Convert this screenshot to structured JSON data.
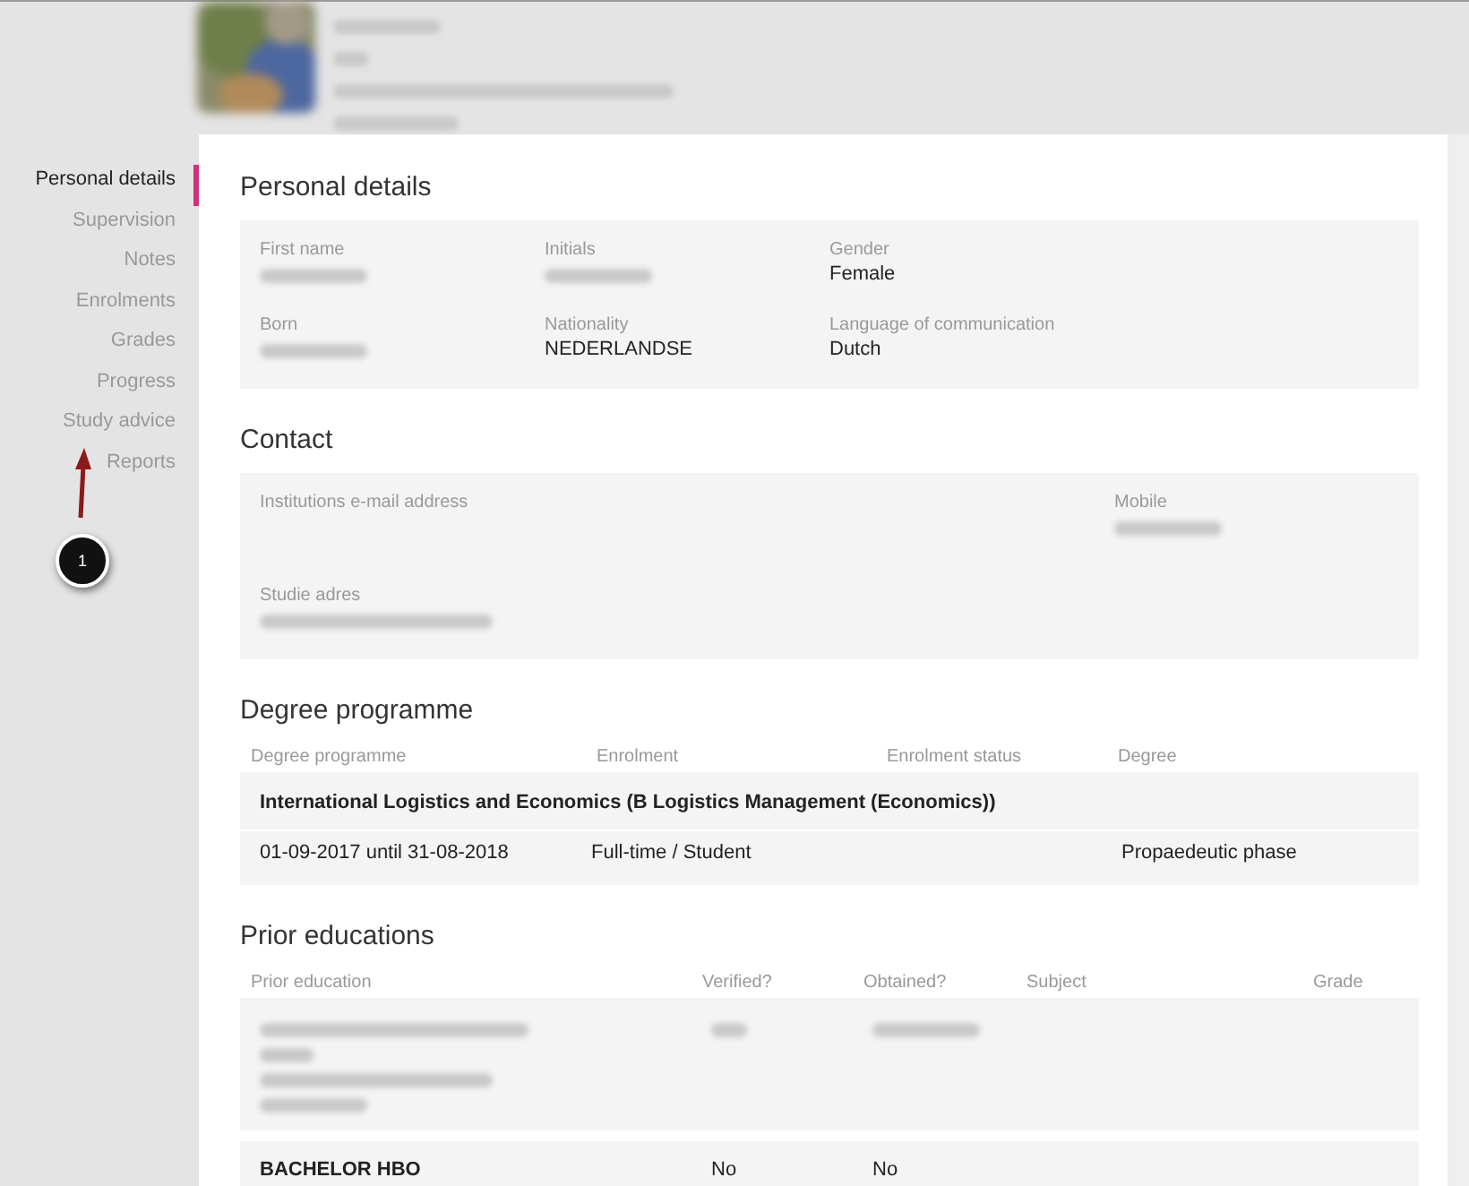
{
  "sidebar": {
    "items": [
      {
        "label": "Personal details",
        "selected": true
      },
      {
        "label": "Supervision",
        "selected": false
      },
      {
        "label": "Notes",
        "selected": false
      },
      {
        "label": "Enrolments",
        "selected": false
      },
      {
        "label": "Grades",
        "selected": false
      },
      {
        "label": "Progress",
        "selected": false
      },
      {
        "label": "Study advice",
        "selected": false
      },
      {
        "label": "Reports",
        "selected": false
      }
    ]
  },
  "annotation": {
    "badge": "1"
  },
  "sections": [
    {
      "kind": "details",
      "title": "Personal details",
      "rows": [
        [
          {
            "label": "First name",
            "redacted": true
          },
          {
            "label": "Initials",
            "redacted": true
          },
          {
            "label": "Gender",
            "value": "Female"
          }
        ],
        [
          {
            "label": "Born",
            "redacted": true
          },
          {
            "label": "Nationality",
            "value": "NEDERLANDSE"
          },
          {
            "label": "Language of communication",
            "value": "Dutch"
          }
        ]
      ]
    },
    {
      "kind": "contact",
      "title": "Contact",
      "rows": [
        [
          {
            "label": "Institutions e-mail address"
          },
          {
            "label": "Mobile",
            "redacted": true
          }
        ],
        [
          {
            "label": "Studie adres",
            "redacted": true
          }
        ]
      ]
    },
    {
      "kind": "degree",
      "title": "Degree programme",
      "columns": [
        "Degree programme",
        "Enrolment",
        "Enrolment status",
        "Degree"
      ],
      "groups": [
        {
          "title": "International Logistics and Economics (B Logistics Management (Economics))",
          "rows": [
            [
              "01-09-2017 until 31-08-2018",
              "Full-time / Student",
              null,
              "Propaedeutic phase"
            ]
          ]
        }
      ]
    },
    {
      "kind": "prior",
      "title": "Prior educations",
      "columns": [
        "Prior education",
        "Verified?",
        "Obtained?",
        "Subject",
        "Grade"
      ],
      "rows": [
        {
          "redacted": true
        },
        {
          "title": "BACHELOR HBO",
          "verified": "No",
          "obtained": "No"
        }
      ]
    }
  ]
}
